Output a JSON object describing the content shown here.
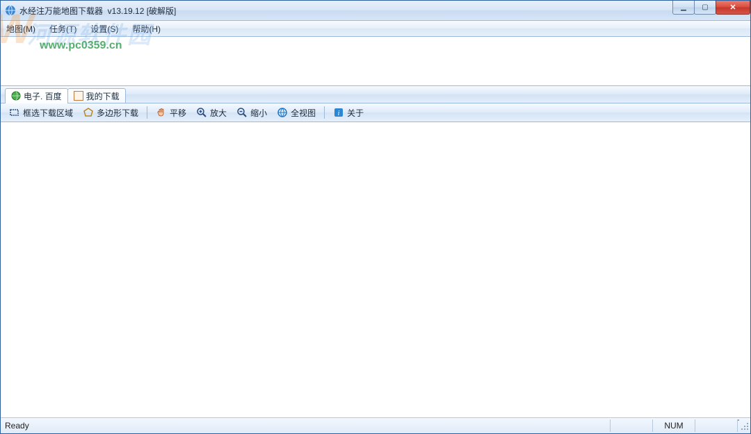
{
  "title": "水经注万能地图下载器  v13.19.12 [破解版]",
  "menubar": {
    "items": [
      {
        "label": "地图(M)"
      },
      {
        "label": "任务(T)"
      },
      {
        "label": "设置(S)"
      },
      {
        "label": "帮助(H)"
      }
    ]
  },
  "tabs": {
    "items": [
      {
        "label": "电子. 百度",
        "icon": "globe-icon"
      },
      {
        "label": "我的下载",
        "icon": "document-icon"
      }
    ],
    "active_index": 0
  },
  "toolbar": {
    "items": [
      {
        "icon": "rect-select-icon",
        "label": "框选下载区域"
      },
      {
        "icon": "polygon-icon",
        "label": "多边形下载"
      },
      {
        "sep": true
      },
      {
        "icon": "hand-pan-icon",
        "label": "平移"
      },
      {
        "icon": "zoom-in-icon",
        "label": "放大"
      },
      {
        "icon": "zoom-out-icon",
        "label": "缩小"
      },
      {
        "icon": "full-extent-icon",
        "label": "全视图"
      },
      {
        "sep": true
      },
      {
        "icon": "about-icon",
        "label": "关于"
      }
    ]
  },
  "statusbar": {
    "left": "Ready",
    "panes": [
      "",
      "NUM",
      ""
    ]
  },
  "watermark": {
    "name_cn": "河源软件园",
    "url": "www.pc0359.cn",
    "w": "W"
  },
  "window_controls": {
    "minimize": "minimize",
    "maximize": "maximize",
    "close": "close"
  }
}
